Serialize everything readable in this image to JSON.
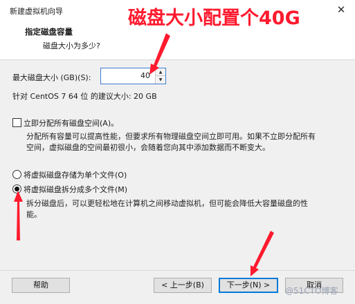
{
  "window": {
    "title": "新建虚拟机向导",
    "close_glyph": "✕"
  },
  "header": {
    "title": "指定磁盘容量",
    "subtitle": "磁盘大小为多少?"
  },
  "disk_size": {
    "label": "最大磁盘大小 (GB)(S):",
    "value": "40",
    "recommendation": "针对 CentOS 7 64 位 的建议大小: 20 GB"
  },
  "allocate": {
    "label": "立即分配所有磁盘空间(A)。",
    "checked": false,
    "desc_line1": "分配所有容量可以提高性能，但要求所有物理磁盘空间立即可用。如果不立即分配所有",
    "desc_line2": "空间，虚拟磁盘的空间最初很小，会随着您向其中添加数据而不断变大。"
  },
  "storage_options": [
    {
      "label": "将虚拟磁盘存储为单个文件(O)",
      "selected": false
    },
    {
      "label": "将虚拟磁盘拆分成多个文件(M)",
      "selected": true
    }
  ],
  "split_desc": {
    "line1": "拆分磁盘后，可以更轻松地在计算机之间移动虚拟机，但可能会降低大容量磁盘的性",
    "line2": "能。"
  },
  "buttons": {
    "help": "帮助",
    "back": "< 上一步(B)",
    "next": "下一步(N) >",
    "cancel": "取消"
  },
  "annotation": "磁盘大小配置个40G",
  "watermark": "@51CTO博客",
  "colors": {
    "annotation": "#ff1a2e",
    "accent": "#0078d7"
  }
}
